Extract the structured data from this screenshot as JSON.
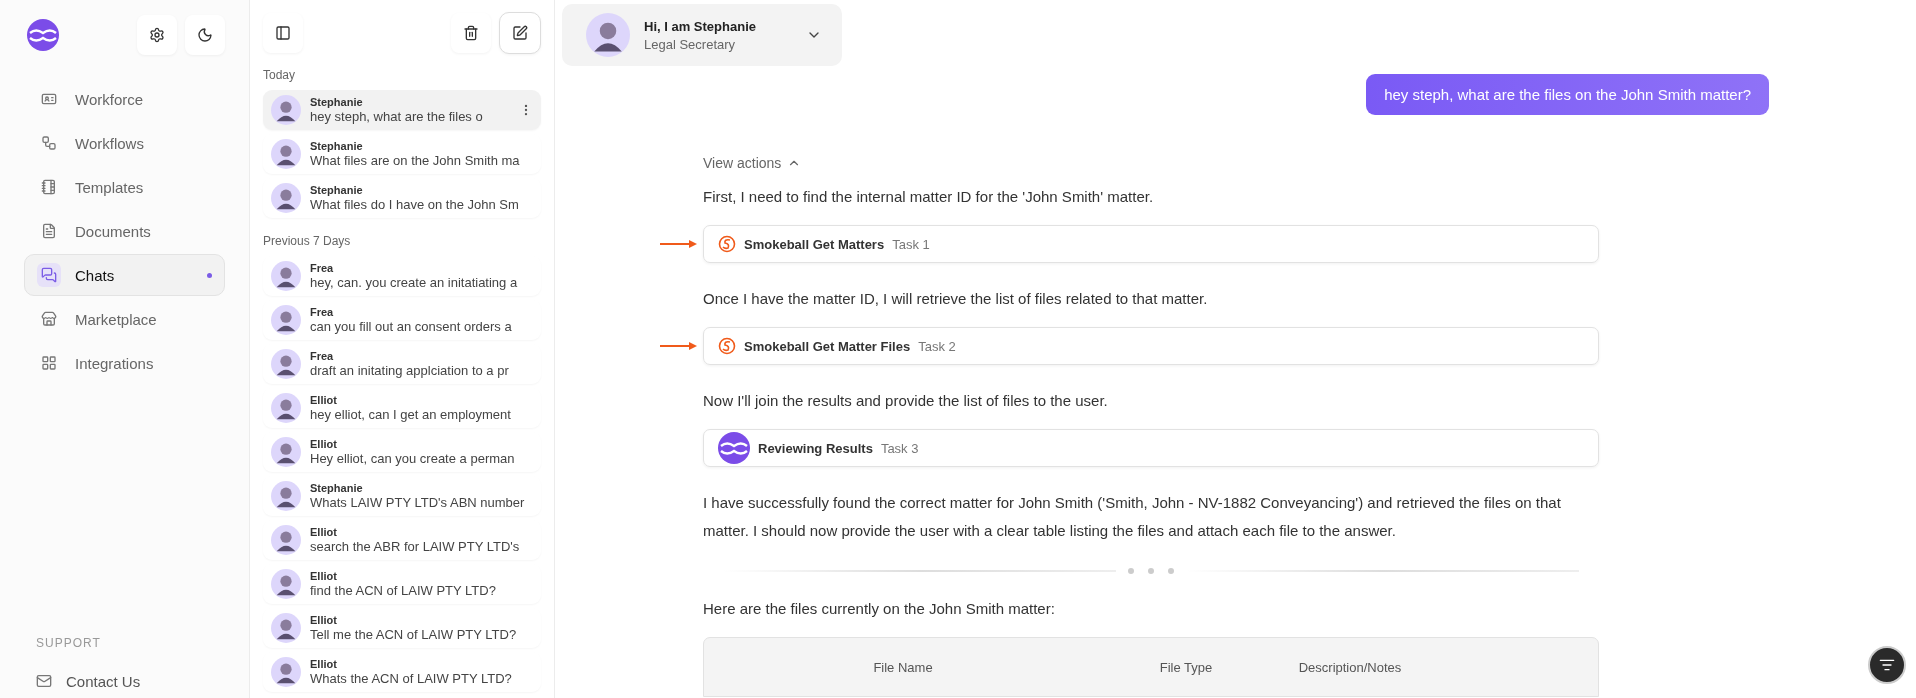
{
  "sidebar": {
    "items": [
      {
        "label": "Workforce",
        "selected": false,
        "dot": false
      },
      {
        "label": "Workflows",
        "selected": false,
        "dot": false
      },
      {
        "label": "Templates",
        "selected": false,
        "dot": false
      },
      {
        "label": "Documents",
        "selected": false,
        "dot": false
      },
      {
        "label": "Chats",
        "selected": true,
        "dot": true
      },
      {
        "label": "Marketplace",
        "selected": false,
        "dot": false
      },
      {
        "label": "Integrations",
        "selected": false,
        "dot": false
      }
    ],
    "support": {
      "heading": "SUPPORT",
      "items": [
        {
          "label": "Contact Us"
        }
      ]
    }
  },
  "chat_list": {
    "groups": [
      {
        "label": "Today",
        "chats": [
          {
            "name": "Stephanie",
            "preview": "hey steph, what are the files o",
            "selected": true
          },
          {
            "name": "Stephanie",
            "preview": "What files are on the John Smith ma",
            "selected": false
          },
          {
            "name": "Stephanie",
            "preview": "What files do I have on the John Sm",
            "selected": false
          }
        ]
      },
      {
        "label": "Previous 7 Days",
        "chats": [
          {
            "name": "Frea",
            "preview": "hey, can. you create an initatiating a",
            "selected": false
          },
          {
            "name": "Frea",
            "preview": "can you fill out an consent orders a",
            "selected": false
          },
          {
            "name": "Frea",
            "preview": "draft an initating applciation to a pr",
            "selected": false
          },
          {
            "name": "Elliot",
            "preview": "hey elliot, can I get an employment",
            "selected": false
          },
          {
            "name": "Elliot",
            "preview": "Hey elliot, can you create a perman",
            "selected": false
          },
          {
            "name": "Stephanie",
            "preview": "Whats LAIW PTY LTD's ABN number",
            "selected": false
          },
          {
            "name": "Elliot",
            "preview": "search the ABR for LAIW PTY LTD's",
            "selected": false
          },
          {
            "name": "Elliot",
            "preview": "find the ACN of LAIW PTY LTD?",
            "selected": false
          },
          {
            "name": "Elliot",
            "preview": "Tell me the ACN of LAIW PTY LTD?",
            "selected": false
          },
          {
            "name": "Elliot",
            "preview": "Whats the ACN of LAIW PTY LTD?",
            "selected": false
          }
        ]
      }
    ]
  },
  "agent": {
    "greeting": "Hi, I am Stephanie",
    "role": "Legal Secretary"
  },
  "user_message": "hey steph, what are the files on the John Smith matter?",
  "actions": {
    "toggle": "View actions",
    "expanded": true,
    "steps": [
      {
        "text": "First, I need to find the internal matter ID for the 'John Smith' matter.",
        "task": {
          "kind": "smokeball",
          "name": "Smokeball Get Matters",
          "label": "Task 1",
          "annotated": true
        }
      },
      {
        "text": "Once I have the matter ID, I will retrieve the list of files related to that matter.",
        "task": {
          "kind": "smokeball",
          "name": "Smokeball Get Matter Files",
          "label": "Task 2",
          "annotated": true
        }
      },
      {
        "text": "Now I'll join the results and provide the list of files to the user.",
        "task": {
          "kind": "app",
          "name": "Reviewing Results",
          "label": "Task 3",
          "annotated": false
        }
      }
    ],
    "summary": "I have successfully found the correct matter for John Smith ('Smith, John - NV-1882 Conveyancing') and retrieved the files on that matter. I should now provide the user with a clear table listing the files and attach each file to the answer."
  },
  "answer": {
    "intro": "Here are the files currently on the John Smith matter:",
    "table": {
      "columns": [
        "File Name",
        "File Type",
        "Description/Notes"
      ]
    }
  }
}
